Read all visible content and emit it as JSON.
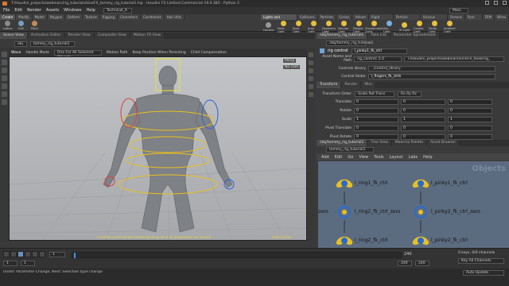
{
  "window": {
    "title": "T:/Houdini_projects/webinars/rig_tutorials/kineFX_tommy_rig_tutorial1.hip - Houdini FX Limited Commercial 19.0.383 - Python 3"
  },
  "menu": {
    "items": [
      "File",
      "Edit",
      "Render",
      "Assets",
      "Windows",
      "Help"
    ],
    "desktop": "Technical_A",
    "main_label": "Main"
  },
  "shelf": {
    "left_tabs": [
      "Create",
      "Modify",
      "Model",
      "Polygon",
      "Deform",
      "Texture",
      "Rigging",
      "Characters",
      "Constraints",
      "Hair Utils",
      "Guide Process",
      "Terrain FX",
      "Simple FX",
      "Volume"
    ],
    "left_tools": [
      "Lattice",
      "Edit",
      "Paint",
      "Cluster",
      "Group",
      "Blend Shapes"
    ],
    "right_tabs": [
      "Lights and Cameras",
      "Collisions",
      "Particles",
      "Grains",
      "Vellum",
      "Rigid Bodies",
      "Particle Fluids",
      "Viscous Fluids",
      "Oceans",
      "Pyro FX",
      "FEM",
      "Wires",
      "Crowds",
      "Drive Simulation"
    ],
    "right_tools": [
      "Camera",
      "Point Light",
      "Spot Light",
      "Area Light",
      "Geometry Light",
      "Volume Light",
      "Distant Light",
      "Environment Light",
      "Sky Light",
      "GI Light",
      "Caustic Light",
      "Portal Light",
      "Ambient Light"
    ]
  },
  "scene_tabs": [
    "Scene View",
    "Animation Editor",
    "Render View",
    "Composite View",
    "Motion FX View"
  ],
  "viewport": {
    "path": "obj",
    "node": "tommy_rig_tutorial1",
    "mode": "Wave",
    "handle_mode": "Handle Mode",
    "target": "One For All Selected Objects",
    "motion_path": "Motion Path",
    "keep_position": "Keep Position When Parenting",
    "child_comp": "Child Compensation",
    "persp": "Persp",
    "cam": "No cam",
    "warning": "A handle could not be created because all of its parameters are locked.",
    "indie": "Indie Edition"
  },
  "params": {
    "tabs": [
      "/obj/tommy_rig_tutorial1",
      "Take List",
      "Parameter Spreadsheet"
    ],
    "header_type": "rig control",
    "header_name": "l_pinky1_fk_ctrl",
    "asset_label": "Asset Name and Path",
    "asset_value": "rig_control::1.0",
    "asset_path": "T:/Houdini_projects/webinars/kineFX_tools/rig_",
    "library_label": "Controls library",
    "library_value": "../control_library",
    "folder_label": "Control folder",
    "folder_value": "l_fingers_fk_ctrls",
    "sub_tabs": [
      "Transform",
      "Render",
      "Misc"
    ],
    "transform_order_label": "Transform Order",
    "transform_order": "Scale Rot Trans",
    "rotate_order": "Rx Ry Rz",
    "rows": [
      {
        "label": "Translate",
        "values": [
          "0",
          "0",
          "0"
        ]
      },
      {
        "label": "Rotate",
        "values": [
          "0",
          "0",
          "0"
        ]
      },
      {
        "label": "Scale",
        "values": [
          "1",
          "1",
          "1"
        ]
      },
      {
        "label": "Pivot Translate",
        "values": [
          "0",
          "0",
          "0"
        ]
      },
      {
        "label": "Pivot Rotate",
        "values": [
          "0",
          "0",
          "0"
        ]
      }
    ]
  },
  "network": {
    "tabs": [
      "/obj/tommy_rig_tutorial1",
      "Tree View",
      "Material Palette",
      "Asset Browser"
    ],
    "path": "tommy_rig_tutorial1",
    "menu": [
      "Add",
      "Edit",
      "Go",
      "View",
      "Tools",
      "Layout",
      "Labs",
      "Help"
    ],
    "watermark": "Objects",
    "nodes": [
      "l_ring1_fk_ctrl",
      "l_pinky1_fk_ctrl",
      "l_ring2_fk_ctrl_zero",
      "l_pinky2_fk_ctrl_zero",
      "l_ring2_fk_ctrl",
      "l_pinky2_fk_ctrl"
    ],
    "left_cut_a": "zero",
    "left_cut_b": "zero"
  },
  "timeline": {
    "frame": "1",
    "start": "1",
    "end": "240",
    "end2": "240",
    "keys": "0 keys, 0/0 channels",
    "key_all": "Key All Channels",
    "auto": "Auto Update"
  },
  "status": {
    "text": "Undid: Parameter Change; Next: Selection type change"
  }
}
